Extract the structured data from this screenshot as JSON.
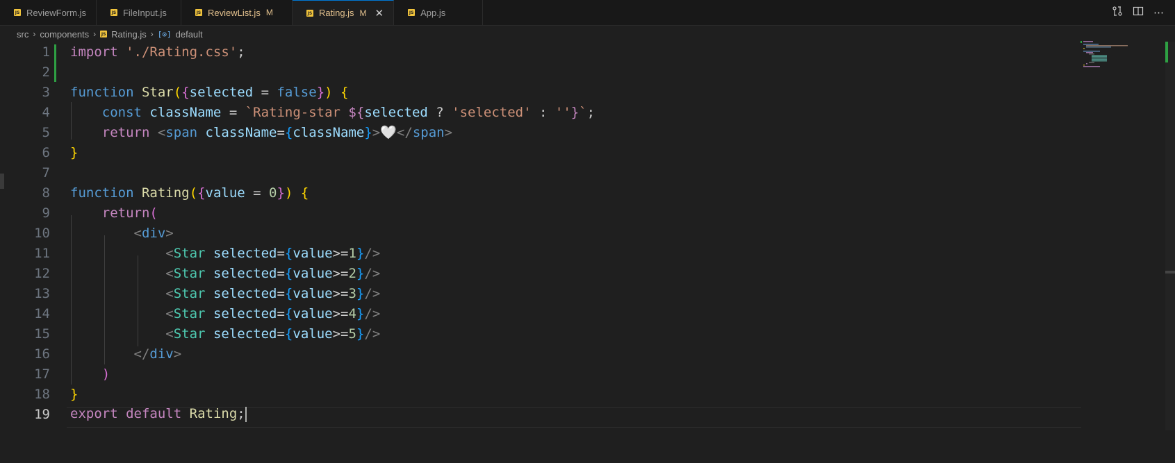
{
  "tabs": [
    {
      "label": "ReviewForm.js",
      "modified": "",
      "active": false
    },
    {
      "label": "FileInput.js",
      "modified": "",
      "active": false
    },
    {
      "label": "ReviewList.js",
      "modified": "M",
      "active": false
    },
    {
      "label": "Rating.js",
      "modified": "M",
      "active": true
    },
    {
      "label": "App.js",
      "modified": "",
      "active": false
    }
  ],
  "breadcrumb": {
    "items": [
      "src",
      "components",
      "Rating.js"
    ],
    "symbol": "default"
  },
  "editor": {
    "line_numbers": [
      "1",
      "2",
      "3",
      "4",
      "5",
      "6",
      "7",
      "8",
      "9",
      "10",
      "11",
      "12",
      "13",
      "14",
      "15",
      "16",
      "17",
      "18",
      "19"
    ],
    "current_line": "19",
    "code": {
      "l1_import": "import",
      "l1_path": "'./Rating.css'",
      "l3_function": "function",
      "l3_name": "Star",
      "l3_param": "selected",
      "l3_default": "false",
      "l4_const": "const",
      "l4_var": "className",
      "l4_tpl_start": "`Rating-star ",
      "l4_cond": "selected",
      "l4_str_selected": "'selected'",
      "l4_str_empty": "''",
      "l5_return": "return",
      "l5_span": "span",
      "l5_attr": "className",
      "l5_value": "className",
      "l5_emoji": "🤍",
      "l8_function": "function",
      "l8_name": "Rating",
      "l8_param": "value",
      "l8_default": "0",
      "l9_return": "return",
      "div": "div",
      "star": "Star",
      "star_attr": "selected",
      "star_value": "value",
      "star_nums": [
        "1",
        "2",
        "3",
        "4",
        "5"
      ],
      "l19_export": "export",
      "l19_default": "default",
      "l19_name": "Rating"
    }
  },
  "colors": {
    "accent": "#0078d4",
    "modified_tab": "#e2c08d",
    "git_added": "#2ea043",
    "js_icon": "#f0c33c"
  }
}
